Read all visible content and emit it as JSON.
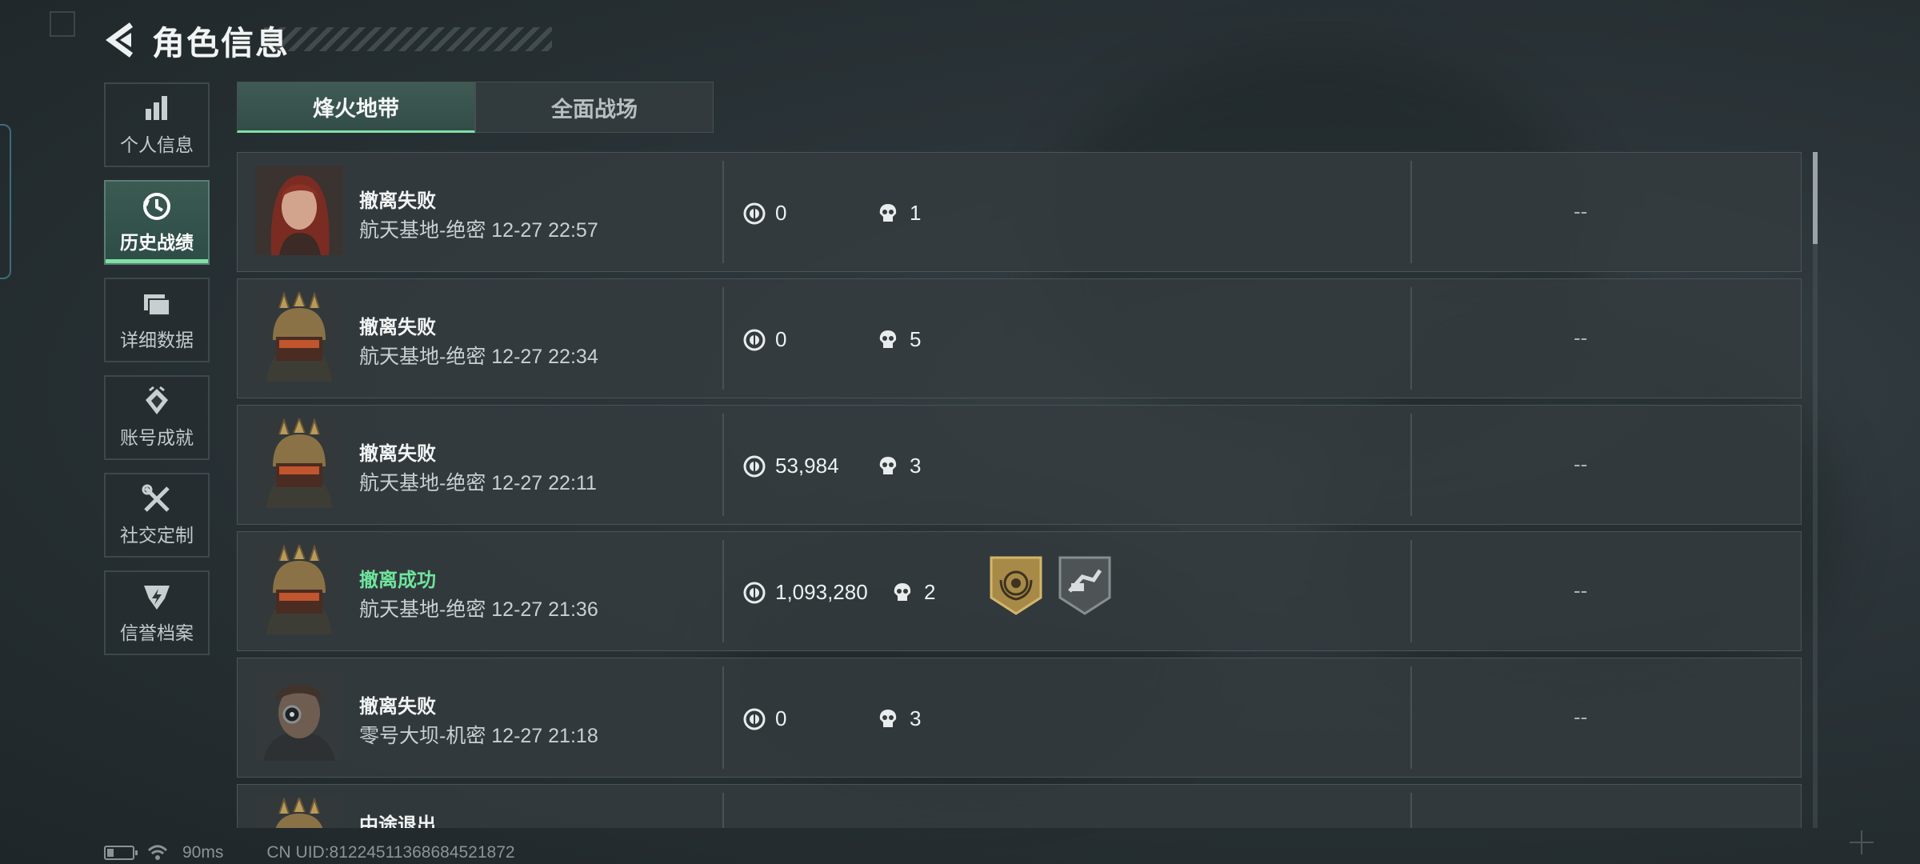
{
  "header": {
    "title": "角色信息"
  },
  "sidebar": {
    "items": [
      {
        "label": "个人信息",
        "icon": "bar-chart-icon",
        "active": false
      },
      {
        "label": "历史战绩",
        "icon": "history-clock-icon",
        "active": true
      },
      {
        "label": "详细数据",
        "icon": "folder-icon",
        "active": false
      },
      {
        "label": "账号成就",
        "icon": "achievement-icon",
        "active": false
      },
      {
        "label": "社交定制",
        "icon": "tools-icon",
        "active": false
      },
      {
        "label": "信誉档案",
        "icon": "credit-shield-icon",
        "active": false
      }
    ]
  },
  "tabs": [
    {
      "label": "烽火地带",
      "active": true
    },
    {
      "label": "全面战场",
      "active": false
    }
  ],
  "matches": [
    {
      "status": "撤离失败",
      "success": false,
      "detail": "航天基地-绝密 12-27 22:57",
      "value": "0",
      "kills": "1",
      "extra": "--",
      "avatar": "red-hair-woman"
    },
    {
      "status": "撤离失败",
      "success": false,
      "detail": "航天基地-绝密 12-27 22:34",
      "value": "0",
      "kills": "5",
      "extra": "--",
      "avatar": "crowned-helmet-soldier"
    },
    {
      "status": "撤离失败",
      "success": false,
      "detail": "航天基地-绝密 12-27 22:11",
      "value": "53,984",
      "kills": "3",
      "extra": "--",
      "avatar": "crowned-helmet-soldier"
    },
    {
      "status": "撤离成功",
      "success": true,
      "detail": "航天基地-绝密 12-27 21:36",
      "value": "1,093,280",
      "kills": "2",
      "extra": "--",
      "avatar": "crowned-helmet-soldier"
    },
    {
      "status": "撤离失败",
      "success": false,
      "detail": "零号大坝-机密 12-27 21:18",
      "value": "0",
      "kills": "3",
      "extra": "--",
      "avatar": "cyber-eye-soldier"
    },
    {
      "status": "中途退出",
      "success": false,
      "detail": "",
      "value": "",
      "kills": "",
      "extra": "",
      "avatar": "crowned-helmet-soldier"
    }
  ],
  "footer": {
    "ping": "90ms",
    "uid": "CN UID:8122451136868452187​2"
  },
  "colors": {
    "accent_green": "#7fe0a6",
    "success_green": "#6fe49c",
    "row_bg": "#343c3f"
  }
}
